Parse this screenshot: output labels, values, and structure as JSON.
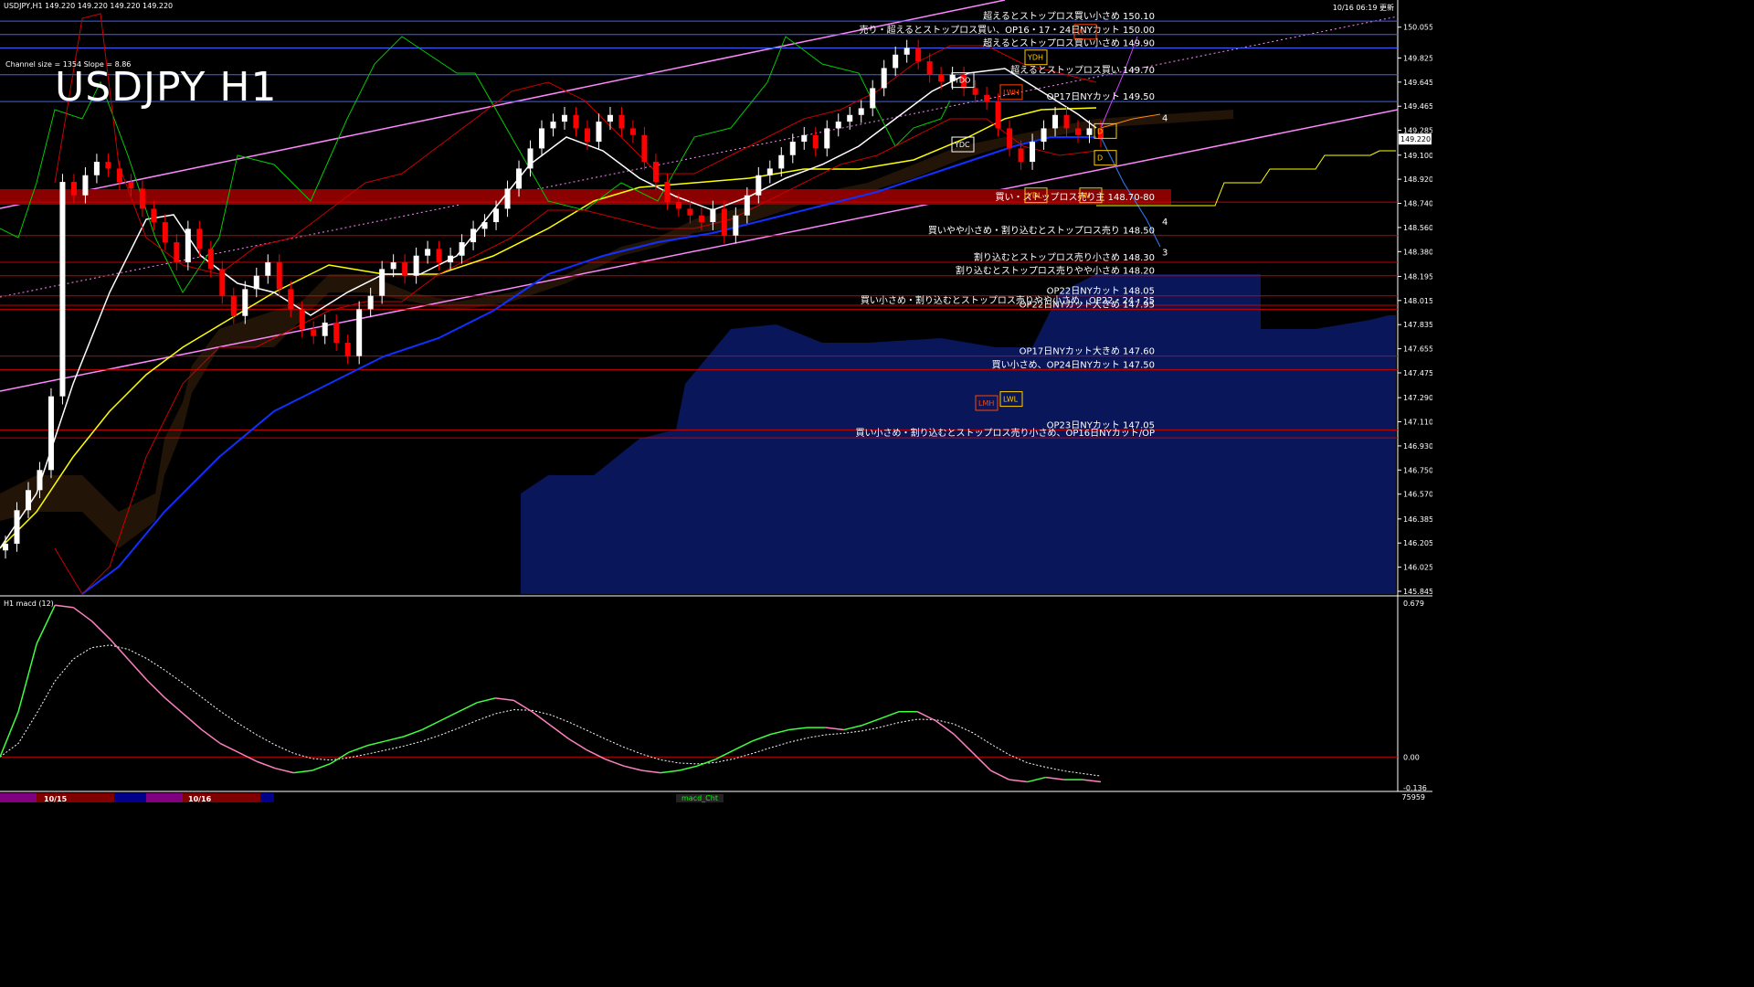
{
  "window": {
    "symbol_header": "USDJPY,H1  149.220 149.220 149.220 149.220",
    "update_time": "10/16 06:19 更新",
    "channel_info": "Channel size = 1354 Slope = 8.86",
    "big_title": "USDJPY H1",
    "macd_header": "H1  macd (12)",
    "bottom_counter": "75959",
    "macd_tab": "macd_Cht"
  },
  "colors": {
    "bg": "#000000",
    "up_candle": "#ffffff",
    "down_candle": "#ff0000",
    "level_line": "#cc0000",
    "blue_line": "#4060ff",
    "channel": "#ff88ff",
    "ma_white": "#ffffff",
    "ma_yellow": "#ffff00",
    "ma_blue": "#1030ff",
    "chikou_green": "#00cc00",
    "macd_green": "#40ff40",
    "macd_pink": "#ff80c0",
    "red_band": "#8b0000"
  },
  "chart_data": {
    "type": "candlestick",
    "title": "USDJPY H1",
    "ylim": [
      145.845,
      150.06
    ],
    "price_ticks": [
      "150.055",
      "149.825",
      "149.645",
      "149.465",
      "149.285",
      "149.100",
      "148.920",
      "148.740",
      "148.560",
      "148.380",
      "148.195",
      "148.015",
      "147.835",
      "147.655",
      "147.475",
      "147.290",
      "147.110",
      "146.930",
      "146.750",
      "146.570",
      "146.385",
      "146.205",
      "146.025",
      "145.845"
    ],
    "current_price": "149.220",
    "date_labels": [
      "10/15",
      "10/16"
    ],
    "closes": [
      146.2,
      146.45,
      146.6,
      146.75,
      147.3,
      148.9,
      148.8,
      148.95,
      149.05,
      149.0,
      148.9,
      148.85,
      148.7,
      148.6,
      148.45,
      148.3,
      148.55,
      148.4,
      148.25,
      148.05,
      147.9,
      148.1,
      148.2,
      148.3,
      148.1,
      147.95,
      147.8,
      147.75,
      147.85,
      147.7,
      147.6,
      147.95,
      148.05,
      148.25,
      148.3,
      148.2,
      148.35,
      148.4,
      148.3,
      148.35,
      148.45,
      148.55,
      148.6,
      148.7,
      148.85,
      149.0,
      149.15,
      149.3,
      149.35,
      149.4,
      149.3,
      149.2,
      149.35,
      149.4,
      149.3,
      149.25,
      149.05,
      148.9,
      148.75,
      148.7,
      148.65,
      148.6,
      148.7,
      148.5,
      148.65,
      148.8,
      148.95,
      149.0,
      149.1,
      149.2,
      149.25,
      149.15,
      149.3,
      149.35,
      149.4,
      149.45,
      149.6,
      149.75,
      149.85,
      149.9,
      149.8,
      149.7,
      149.65,
      149.7,
      149.6,
      149.55,
      149.5,
      149.3,
      149.15,
      149.05,
      149.2,
      149.3,
      149.4,
      149.3,
      149.25,
      149.3,
      149.22
    ],
    "levels": [
      {
        "price": 150.1,
        "label": "超えるとストップロス買い小さめ 150.10"
      },
      {
        "price": 150.0,
        "label": "売り・超えるとストップロス買い、OP16・17・24日NYカット 150.00"
      },
      {
        "price": 149.9,
        "label": "超えるとストップロス買い小さめ 149.90"
      },
      {
        "price": 149.7,
        "label": "超えるとストップロス買い 149.70"
      },
      {
        "price": 149.5,
        "label": "OP17日NYカット 149.50"
      },
      {
        "price": 148.75,
        "label": "買い・ストップロス売り主 148.70-80"
      },
      {
        "price": 148.5,
        "label": "買いやや小さめ・割り込むとストップロス売り 148.50"
      },
      {
        "price": 148.3,
        "label": "割り込むとストップロス売り小さめ 148.30"
      },
      {
        "price": 148.2,
        "label": "割り込むとストップロス売りやや小さめ 148.20"
      },
      {
        "price": 148.05,
        "label": "OP22日NYカット 148.05"
      },
      {
        "price": 147.98,
        "label": "買い小さめ・割り込むとストップロス売りやや小さめ、OP22・24・25"
      },
      {
        "price": 147.95,
        "label": "OP22日NYカット大きめ 147.95"
      },
      {
        "price": 147.6,
        "label": "OP17日NYカット大きめ 147.60"
      },
      {
        "price": 147.5,
        "label": "買い小さめ、OP24日NYカット 147.50"
      },
      {
        "price": 147.05,
        "label": "OP23日NYカット 147.05"
      },
      {
        "price": 146.99,
        "label": "買い小さめ・割り込むとストップロス売り小さめ、OP16日NYカット/OP"
      }
    ],
    "markers": {
      "ydh": "YDH",
      "ydo": "YDO",
      "ydc": "YDC",
      "ydl": "YDL",
      "lwh": "LWH",
      "lwl": "LWL",
      "lmh": "LMH",
      "w": "W",
      "d": "D",
      "n4": "4",
      "n3": "3"
    },
    "macd": {
      "ylim": [
        -0.136,
        0.679
      ],
      "ticks": [
        "0.679",
        "0.00",
        "-0.136"
      ],
      "values": [
        0.0,
        0.2,
        0.5,
        0.67,
        0.66,
        0.6,
        0.52,
        0.43,
        0.34,
        0.26,
        0.19,
        0.12,
        0.06,
        0.02,
        -0.02,
        -0.05,
        -0.07,
        -0.06,
        -0.03,
        0.02,
        0.05,
        0.07,
        0.09,
        0.12,
        0.16,
        0.2,
        0.24,
        0.26,
        0.25,
        0.2,
        0.14,
        0.08,
        0.03,
        -0.01,
        -0.04,
        -0.06,
        -0.07,
        -0.06,
        -0.04,
        -0.01,
        0.03,
        0.07,
        0.1,
        0.12,
        0.13,
        0.13,
        0.12,
        0.14,
        0.17,
        0.2,
        0.2,
        0.16,
        0.1,
        0.02,
        -0.06,
        -0.1,
        -0.11,
        -0.09,
        -0.1,
        -0.1,
        -0.11
      ]
    }
  }
}
